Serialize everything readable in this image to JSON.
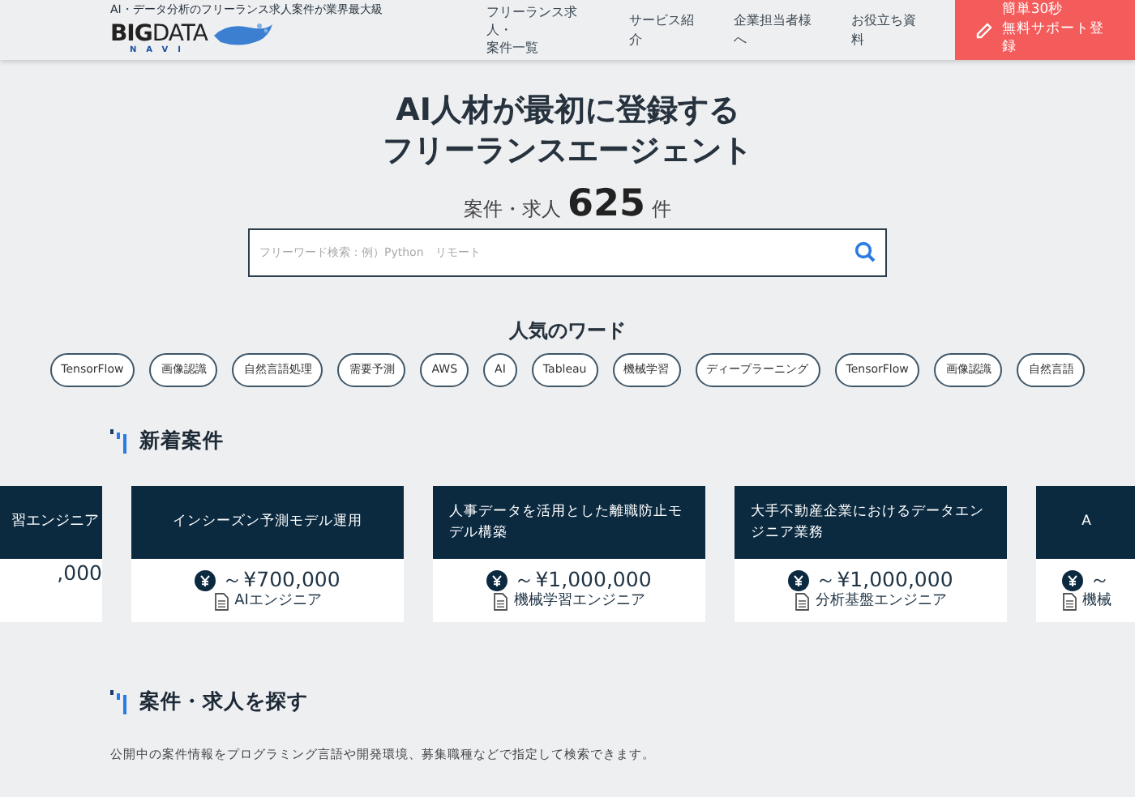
{
  "header": {
    "tagline": "AI・データ分析のフリーランス求人案件が業界最大級",
    "logo": {
      "main": "BIG",
      "accent": "DATA",
      "sub": "NAVI"
    },
    "nav": [
      {
        "label_lines": [
          "フリーランス求人・",
          "案件一覧"
        ]
      },
      {
        "label": "サービス紹介"
      },
      {
        "label": "企業担当者様へ"
      },
      {
        "label": "お役立ち資料"
      }
    ],
    "cta": {
      "line_1": "簡単30秒",
      "line_2": "無料サポート登録"
    }
  },
  "hero": {
    "title_1": "AI人材が最初に登録する",
    "title_2": "フリーランスエージェント",
    "count_label": "案件・求人",
    "count": "625",
    "count_unit": "件",
    "search": {
      "placeholder": "フリーワード検索：例）Python　リモート"
    }
  },
  "popular": {
    "title": "人気のワード",
    "words": [
      "TensorFlow",
      "画像認識",
      "自然言語処理",
      "需要予測",
      "AWS",
      "AI",
      "Tableau",
      "機械学習",
      "ディープラーニング",
      "TensorFlow",
      "画像認識",
      "自然言語"
    ]
  },
  "new_jobs": {
    "title": "新着案件",
    "cards": [
      {
        "kind": "cut_left",
        "title": "習エンジニア",
        "salary": ",000"
      },
      {
        "kind": "full",
        "title": "インシーズン予測モデル運用",
        "salary": "～¥700,000",
        "job": "AIエンジニア"
      },
      {
        "kind": "full",
        "title": "人事データを活用とした離職防止モデル構築",
        "salary": "～¥1,000,000",
        "job": "機械学習エンジニア"
      },
      {
        "kind": "full",
        "title": "大手不動産企業におけるデータエンジニア業務",
        "salary": "～¥1,000,000",
        "job": "分析基盤エンジニア"
      },
      {
        "kind": "cut_right",
        "title": "A",
        "salary": "～",
        "job": "機械"
      }
    ]
  },
  "search_section": {
    "title": "案件・求人を探す",
    "description": "公開中の案件情報をプログラミング言語や開発環境、募集職種などで指定して検索できます。"
  }
}
